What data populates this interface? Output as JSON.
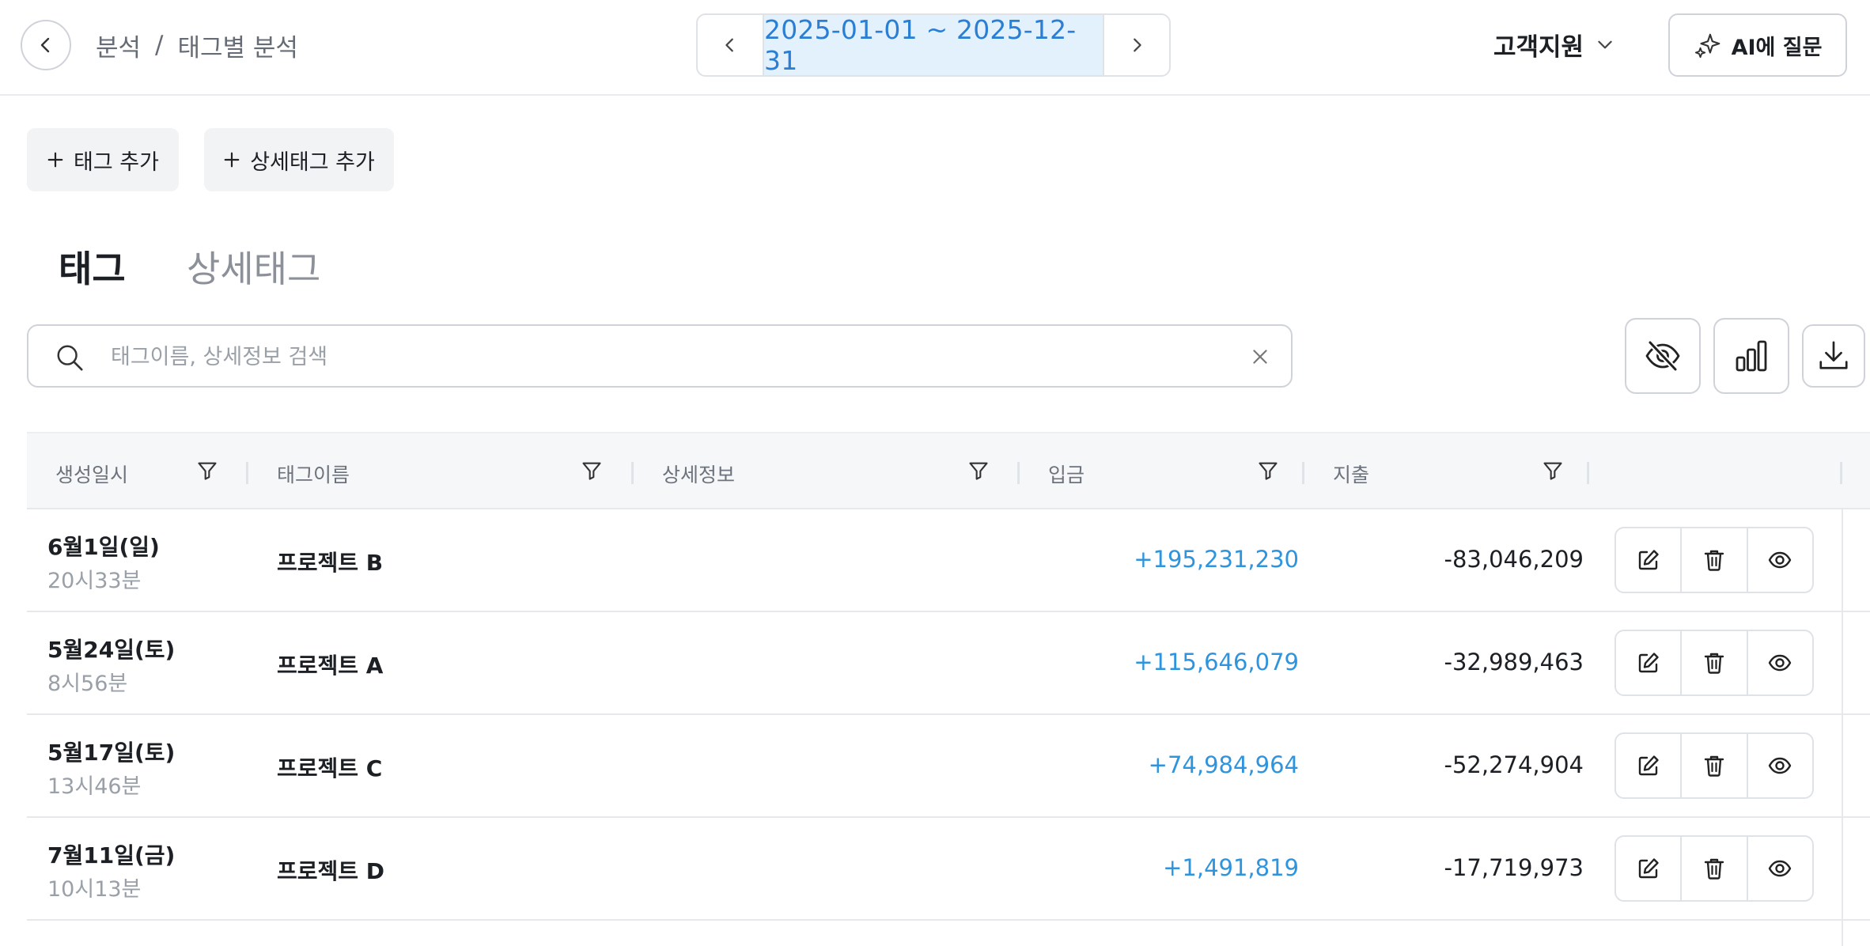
{
  "header": {
    "breadcrumb": {
      "parent": "분석",
      "separator": "/",
      "current": "태그별 분석"
    },
    "date_range": "2025-01-01 ~ 2025-12-31",
    "support_label": "고객지원",
    "ai_button_label": "AI에 질문"
  },
  "actions": {
    "add_tag": "태그 추가",
    "add_detail_tag": "상세태그 추가"
  },
  "tabs": [
    {
      "label": "태그",
      "active": true
    },
    {
      "label": "상세태그",
      "active": false
    }
  ],
  "search": {
    "placeholder": "태그이름, 상세정보 검색",
    "value": ""
  },
  "table": {
    "columns": [
      "생성일시",
      "태그이름",
      "상세정보",
      "입금",
      "지출"
    ],
    "rows": [
      {
        "date": "6월1일(일)",
        "time": "20시33분",
        "name": "프로젝트 B",
        "detail": "",
        "income": "+195,231,230",
        "expense": "-83,046,209"
      },
      {
        "date": "5월24일(토)",
        "time": "8시56분",
        "name": "프로젝트 A",
        "detail": "",
        "income": "+115,646,079",
        "expense": "-32,989,463"
      },
      {
        "date": "5월17일(토)",
        "time": "13시46분",
        "name": "프로젝트 C",
        "detail": "",
        "income": "+74,984,964",
        "expense": "-52,274,904"
      },
      {
        "date": "7월11일(금)",
        "time": "10시13분",
        "name": "프로젝트 D",
        "detail": "",
        "income": "+1,491,819",
        "expense": "-17,719,973"
      }
    ]
  },
  "colors": {
    "accent": "#2a7ed3",
    "income": "#2e94de",
    "date_range_bg": "#e3f1fd"
  },
  "icons": [
    "chevron-left-icon",
    "chevron-right-icon",
    "chevron-down-icon",
    "sparkle-icon",
    "plus-icon",
    "search-icon",
    "clear-icon",
    "eye-off-icon",
    "bar-chart-icon",
    "download-icon",
    "filter-icon",
    "edit-icon",
    "trash-icon",
    "eye-icon"
  ]
}
